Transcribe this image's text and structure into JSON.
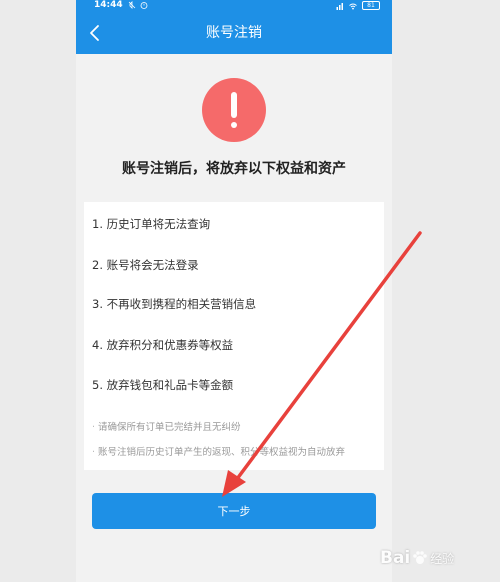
{
  "status_bar": {
    "time": "14:44",
    "battery": "81",
    "left_icons": [
      "mute-icon",
      "alarm-icon"
    ],
    "right_icons": [
      "signal-icon",
      "wifi-icon",
      "battery-icon"
    ]
  },
  "navbar": {
    "title": "账号注销",
    "back_icon": "chevron-left-icon"
  },
  "warning_icon": "exclamation-icon",
  "headline": "账号注销后，将放弃以下权益和资产",
  "items": [
    "1. 历史订单将无法查询",
    "2. 账号将会无法登录",
    "3. 不再收到携程的相关营销信息",
    "4. 放弃积分和优惠券等权益",
    "5. 放弃钱包和礼品卡等金额"
  ],
  "notes": [
    "请确保所有订单已完结并且无纠纷",
    "账号注销后历史订单产生的返现、积分等权益视为自动放弃"
  ],
  "next_button": "下一步",
  "watermark": {
    "brand": "Bai",
    "suffix": "经验"
  },
  "colors": {
    "primary": "#1e90e6",
    "warning": "#f56a6a",
    "annotation_arrow": "#e8413c"
  }
}
